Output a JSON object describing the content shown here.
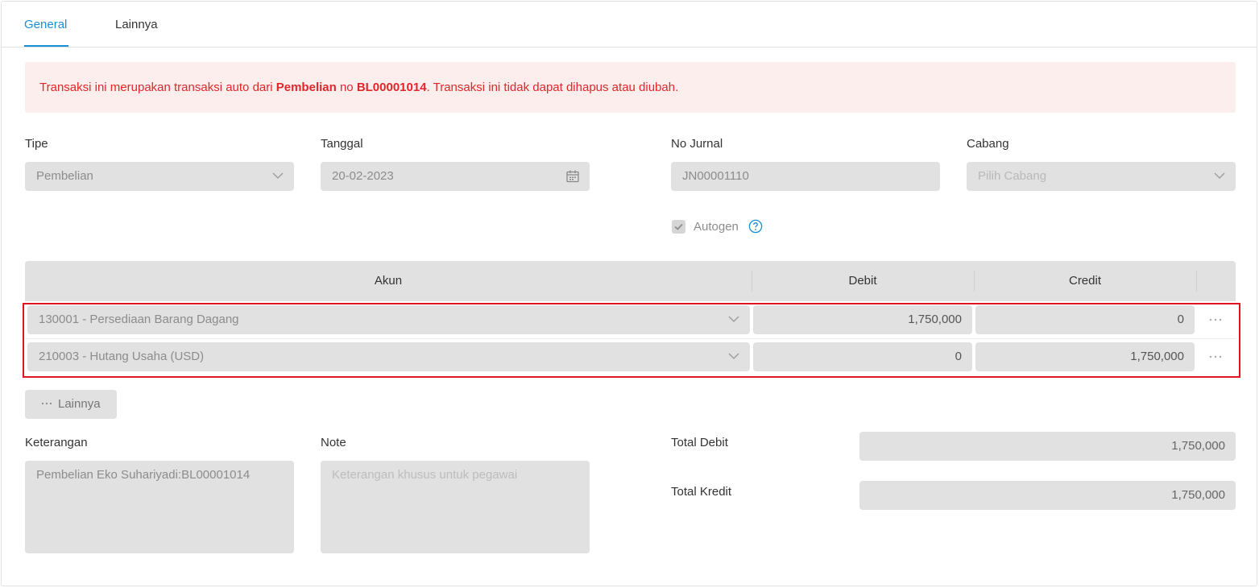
{
  "tabs": [
    {
      "label": "General",
      "active": true
    },
    {
      "label": "Lainnya",
      "active": false
    }
  ],
  "alert": {
    "prefix": "Transaksi ini merupakan transaksi auto dari ",
    "source_type": "Pembelian",
    "middle": " no ",
    "source_number": "BL00001014",
    "suffix": ". Transaksi ini tidak dapat dihapus atau diubah."
  },
  "form": {
    "tipe": {
      "label": "Tipe",
      "value": "Pembelian"
    },
    "tanggal": {
      "label": "Tanggal",
      "value": "20-02-2023"
    },
    "no_jurnal": {
      "label": "No Jurnal",
      "value": "JN00001110"
    },
    "cabang": {
      "label": "Cabang",
      "placeholder": "Pilih Cabang"
    },
    "autogen": {
      "label": "Autogen",
      "checked": true
    }
  },
  "table": {
    "headers": {
      "akun": "Akun",
      "debit": "Debit",
      "credit": "Credit"
    },
    "rows": [
      {
        "akun": "130001 - Persediaan Barang Dagang",
        "debit": "1,750,000",
        "credit": "0"
      },
      {
        "akun": "210003 - Hutang Usaha (USD)",
        "debit": "0",
        "credit": "1,750,000"
      }
    ]
  },
  "more_button": {
    "label": "Lainnya"
  },
  "keterangan": {
    "label": "Keterangan",
    "value": "Pembelian Eko Suhariyadi:BL00001014"
  },
  "note": {
    "label": "Note",
    "placeholder": "Keterangan khusus untuk pegawai"
  },
  "totals": {
    "debit": {
      "label": "Total Debit",
      "value": "1,750,000"
    },
    "kredit": {
      "label": "Total Kredit",
      "value": "1,750,000"
    }
  },
  "colors": {
    "accent": "#1890d6",
    "alert_text": "#e0262b",
    "alert_bg": "#fdeeee",
    "highlight": "#e0141e",
    "field_bg": "#e1e1e1"
  }
}
